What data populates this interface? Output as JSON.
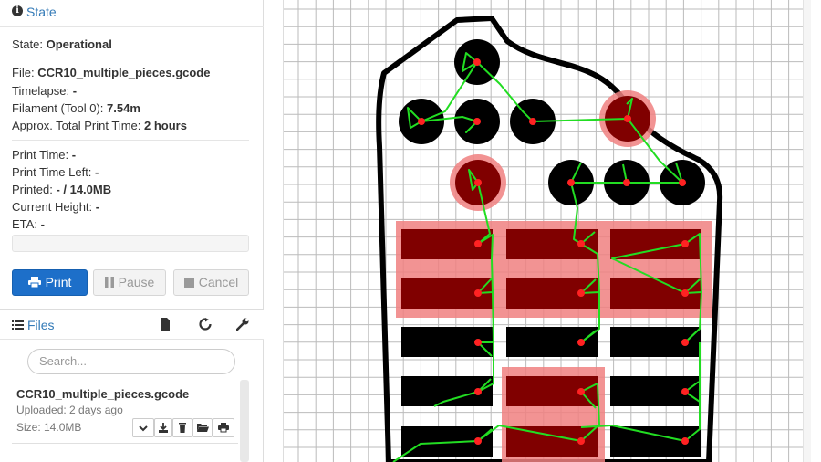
{
  "state": {
    "title": "State",
    "state_label": "State:",
    "state_value": "Operational",
    "file_label": "File:",
    "file_value": "CCR10_multiple_pieces.gcode",
    "timelapse_label": "Timelapse:",
    "timelapse_value": "-",
    "filament_label": "Filament (Tool 0):",
    "filament_value": "7.54m",
    "approx_label": "Approx. Total Print Time:",
    "approx_value": "2 hours",
    "print_time_label": "Print Time:",
    "print_time_value": "-",
    "time_left_label": "Print Time Left:",
    "time_left_value": "-",
    "printed_label": "Printed:",
    "printed_value": "- / 14.0MB",
    "height_label": "Current Height:",
    "height_value": "-",
    "eta_label": "ETA:",
    "eta_value": "-",
    "progress_fraction": 0
  },
  "buttons": {
    "print": "Print",
    "pause": "Pause",
    "cancel": "Cancel"
  },
  "files": {
    "title": "Files",
    "search_placeholder": "Search...",
    "item": {
      "name": "CCR10_multiple_pieces.gcode",
      "uploaded": "Uploaded: 2 days ago",
      "size": "Size: 14.0MB"
    }
  },
  "colors": {
    "link": "#337ab7",
    "print_button": "#1d6fc9",
    "part_highlight": "#f08080",
    "part_selected": "#800000",
    "part_default": "#000000",
    "travel_path": "#22dd22",
    "node": "#ff2222",
    "grid": "#bbbbbb"
  },
  "icons": {
    "state": "info-circle-icon",
    "print": "print-icon",
    "pause": "pause-icon",
    "cancel": "stop-icon",
    "files": "list-icon",
    "new_file": "file-icon",
    "refresh": "refresh-icon",
    "settings": "wrench-icon",
    "file_actions": [
      "chevron-down-icon",
      "download-icon",
      "trash-icon",
      "folder-open-icon",
      "print-icon"
    ]
  }
}
